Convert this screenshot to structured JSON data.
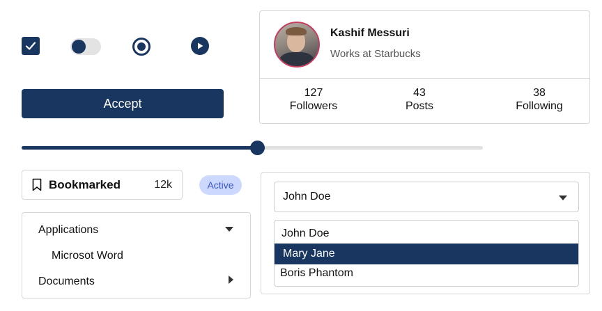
{
  "controls": {
    "checkbox_checked": true,
    "toggle_on": true,
    "radio_selected": true
  },
  "accept_label": "Accept",
  "slider": {
    "value": 0.51
  },
  "bookmark": {
    "label": "Bookmarked",
    "count": "12k"
  },
  "status_badge": "Active",
  "tree": {
    "items": [
      {
        "label": "Applications",
        "expanded": true
      },
      {
        "label": "Microsot Word"
      },
      {
        "label": "Documents",
        "expanded": false
      }
    ]
  },
  "profile": {
    "name": "Kashif Messuri",
    "subtitle": "Works at Starbucks",
    "stats": [
      {
        "value": "127",
        "label": "Followers"
      },
      {
        "value": "43",
        "label": "Posts"
      },
      {
        "value": "38",
        "label": "Following"
      }
    ]
  },
  "select": {
    "value": "John Doe",
    "options": [
      "John Doe",
      "Mary Jane",
      "Boris Phantom"
    ],
    "highlighted": "Mary Jane"
  },
  "colors": {
    "primary": "#18365f",
    "badge_bg": "#cdd8ff",
    "badge_text": "#3656c9",
    "avatar_ring": "#c53e5f"
  }
}
